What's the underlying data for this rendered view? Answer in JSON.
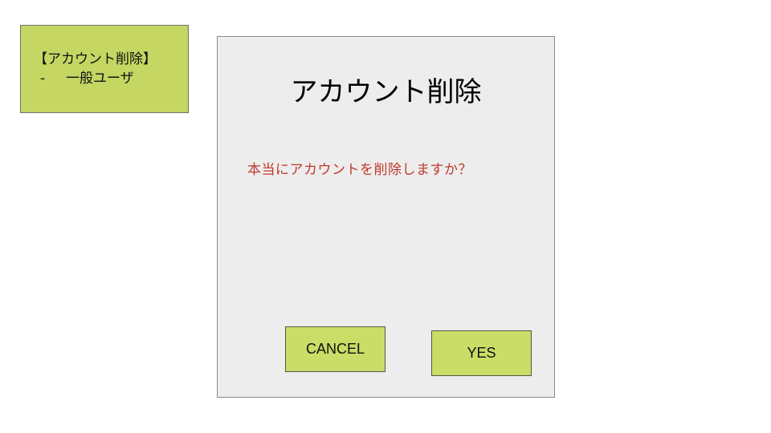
{
  "note": {
    "title": "【アカウント削除】",
    "dash": "-",
    "subtitle": "一般ユーザ"
  },
  "dialog": {
    "title": "アカウント削除",
    "message": "本当にアカウントを削除しますか？",
    "cancel_label": "CANCEL",
    "yes_label": "YES"
  },
  "colors": {
    "note_background": "#c5d662",
    "button_background": "#cadd66",
    "dialog_background": "#ededed",
    "message_text": "#c0392b"
  }
}
